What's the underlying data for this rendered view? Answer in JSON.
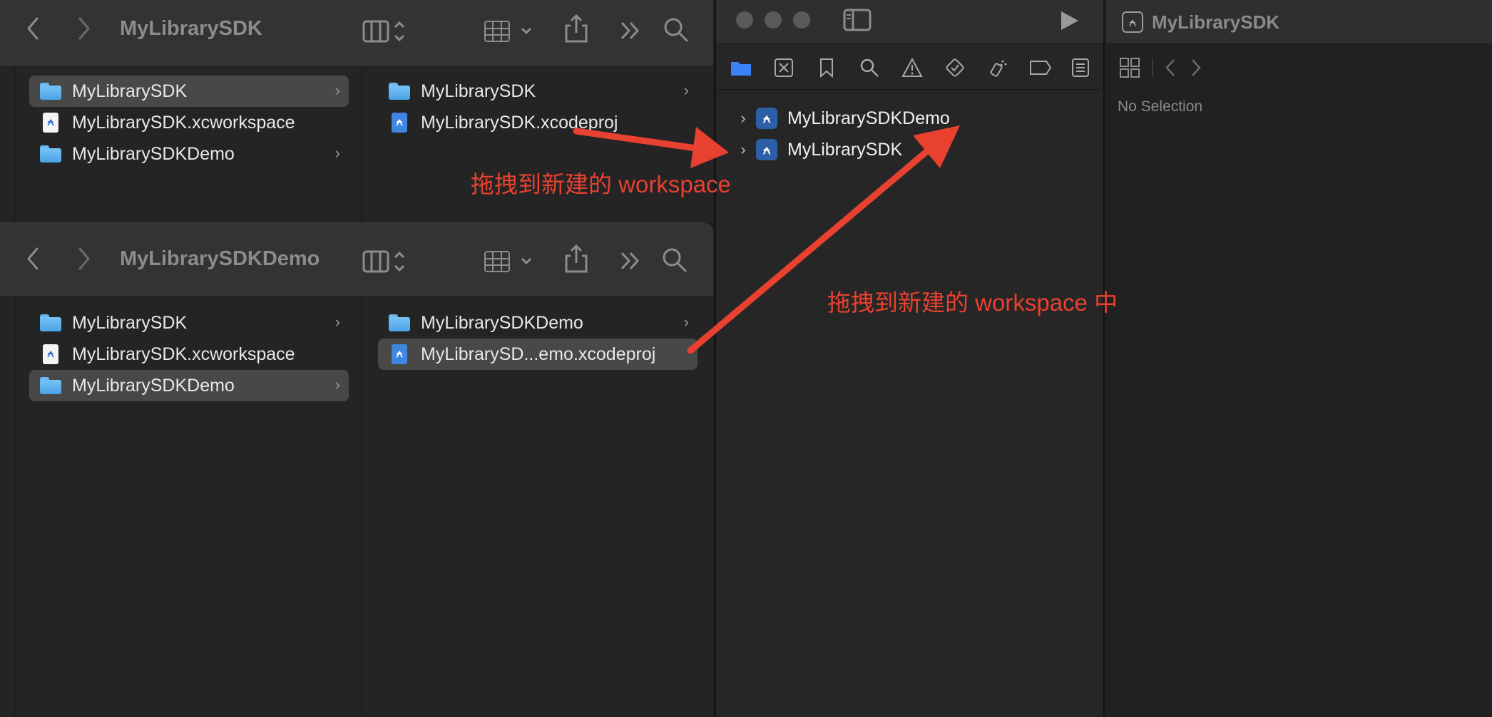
{
  "finder_top": {
    "title": "MyLibrarySDK",
    "column1": [
      {
        "label": "MyLibrarySDK",
        "kind": "folder",
        "selected": true,
        "chevron": true
      },
      {
        "label": "MyLibrarySDK.xcworkspace",
        "kind": "workspace",
        "selected": false,
        "chevron": false
      },
      {
        "label": "MyLibrarySDKDemo",
        "kind": "folder",
        "selected": false,
        "chevron": true
      }
    ],
    "column2": [
      {
        "label": "MyLibrarySDK",
        "kind": "folder",
        "selected": false,
        "chevron": true
      },
      {
        "label": "MyLibrarySDK.xcodeproj",
        "kind": "xcodeproj",
        "selected": false,
        "chevron": false
      }
    ]
  },
  "finder_bottom": {
    "title": "MyLibrarySDKDemo",
    "column1": [
      {
        "label": "MyLibrarySDK",
        "kind": "folder",
        "selected": false,
        "chevron": true
      },
      {
        "label": "MyLibrarySDK.xcworkspace",
        "kind": "workspace",
        "selected": false,
        "chevron": false
      },
      {
        "label": "MyLibrarySDKDemo",
        "kind": "folder",
        "selected": true,
        "chevron": true
      }
    ],
    "column2": [
      {
        "label": "MyLibrarySDKDemo",
        "kind": "folder",
        "selected": false,
        "chevron": true
      },
      {
        "label": "MyLibrarySD...emo.xcodeproj",
        "kind": "xcodeproj",
        "selected": true,
        "chevron": false
      }
    ]
  },
  "xcode": {
    "navigator_items": [
      {
        "label": "MyLibrarySDKDemo"
      },
      {
        "label": "MyLibrarySDK"
      }
    ],
    "inspector_title": "MyLibrarySDK",
    "no_selection": "No Selection"
  },
  "annotations": {
    "first": "拖拽到新建的 workspace",
    "second": "拖拽到新建的 workspace 中"
  },
  "colors": {
    "annotation": "#e8412f",
    "accent": "#3b82f6"
  }
}
